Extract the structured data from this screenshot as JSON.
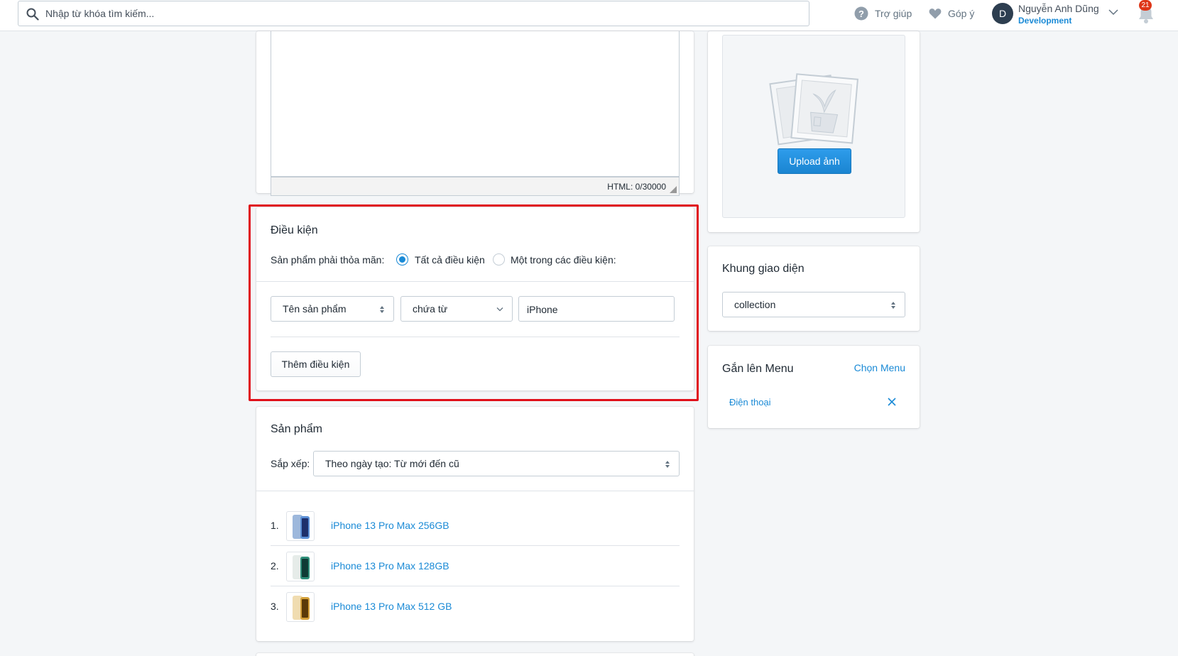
{
  "topbar": {
    "search_placeholder": "Nhập từ khóa tìm kiếm...",
    "help_label": "Trợ giúp",
    "feedback_label": "Góp ý",
    "user": {
      "initial": "D",
      "name": "Nguyễn Anh Dũng",
      "role": "Development"
    },
    "notification_count": "21"
  },
  "editor": {
    "status": "HTML: 0/30000"
  },
  "conditions": {
    "title": "Điều kiện",
    "match_label": "Sản phẩm phải thỏa mãn:",
    "option_all": "Tất cả điều kiện",
    "option_any": "Một trong các điều kiện:",
    "rule": {
      "field": "Tên sản phẩm",
      "operator": "chứa từ",
      "value": "iPhone"
    },
    "add_button": "Thêm điều kiện"
  },
  "products": {
    "title": "Sản phẩm",
    "sort_label": "Sắp xếp:",
    "sort_value": "Theo ngày tạo: Từ mới đến cũ",
    "items": [
      {
        "index": "1.",
        "name": "iPhone 13 Pro Max 256GB",
        "color": "#5a8fd6"
      },
      {
        "index": "2.",
        "name": "iPhone 13 Pro Max 128GB",
        "color": "#2f8f7a"
      },
      {
        "index": "3.",
        "name": "iPhone 13 Pro Max 512 GB",
        "color": "#d4a13a"
      }
    ]
  },
  "image": {
    "upload_button": "Upload ảnh"
  },
  "template": {
    "title": "Khung giao diện",
    "value": "collection"
  },
  "menu": {
    "title": "Gắn lên Menu",
    "choose_link": "Chọn Menu",
    "items": [
      {
        "label": "Điện thoại"
      }
    ]
  },
  "colors": {
    "accent": "#1a8ad6",
    "highlight": "#e0101a",
    "badge": "#de3618"
  }
}
